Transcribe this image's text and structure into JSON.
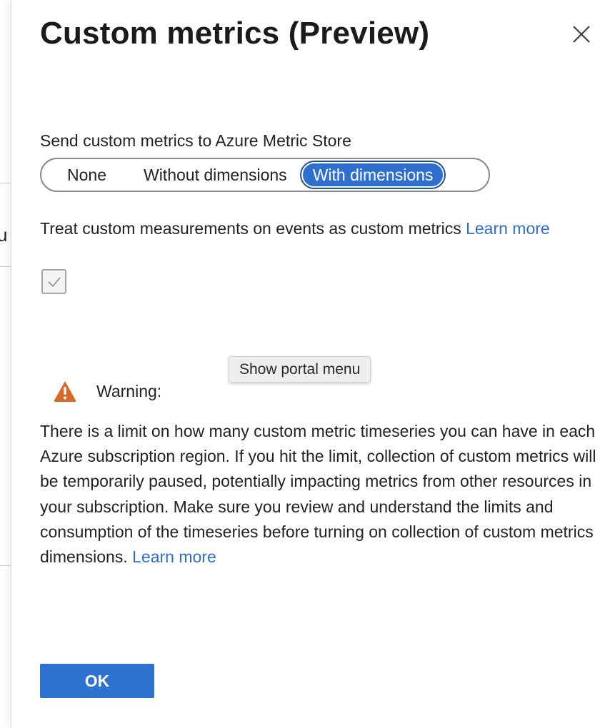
{
  "backdrop": {
    "peek_text": "u"
  },
  "panel": {
    "title": "Custom metrics (Preview)",
    "close_icon": "close-icon"
  },
  "send_metrics": {
    "label": "Send custom metrics to Azure Metric Store",
    "options": [
      "None",
      "Without dimensions",
      "With dimensions"
    ],
    "selected": "With dimensions"
  },
  "measurements": {
    "text": "Treat custom measurements on events as custom metrics",
    "link": "Learn more",
    "checked": true
  },
  "tooltip": {
    "text": "Show portal menu"
  },
  "warning": {
    "icon": "warning-icon",
    "label": "Warning:",
    "body": "There is a limit on how many custom metric timeseries you can have in each Azure subscription region. If you hit the limit, collection of custom metrics will be temporarily paused, potentially impacting metrics from other resources in your subscription. Make sure you review and understand the limits and consumption of the timeseries before turning on collection of custom metrics dimensions.",
    "link": "Learn more"
  },
  "footer": {
    "ok_label": "OK"
  },
  "colors": {
    "accent": "#2f73d1",
    "link": "#2f6fc9",
    "warning": "#d9692a"
  }
}
